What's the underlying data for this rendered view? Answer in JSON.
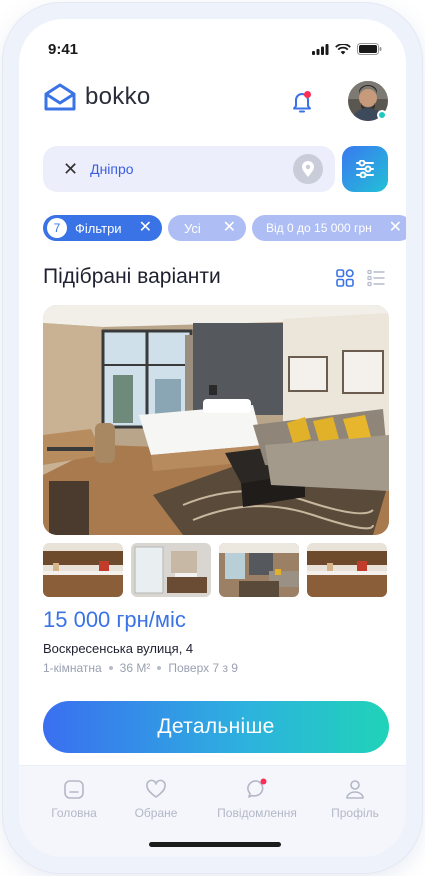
{
  "status_bar": {
    "time": "9:41"
  },
  "header": {
    "logo_text": "bokko"
  },
  "search": {
    "value": "Дніпро"
  },
  "chips": [
    {
      "count": "7",
      "label": "Фільтри"
    },
    {
      "label": "Усі"
    },
    {
      "label": "Від 0 до 15 000 грн"
    }
  ],
  "section": {
    "title": "Підібрані варіанти"
  },
  "listing": {
    "price": "15 000 грн/міс",
    "address": "Воскресенська вулиця, 4",
    "rooms": "1-кімнатна",
    "area": "36 М²",
    "floor": "Поверх 7 з 9"
  },
  "actions": {
    "details_label": "Детальніше"
  },
  "tabbar": {
    "home": "Головна",
    "favorites": "Обране",
    "messages": "Повідомлення",
    "profile": "Профіль"
  },
  "colors": {
    "accent": "#3a73e6",
    "chip_inactive": "#aebdf3",
    "notification_dot": "#ff2d55",
    "online_dot": "#21c8c2"
  }
}
